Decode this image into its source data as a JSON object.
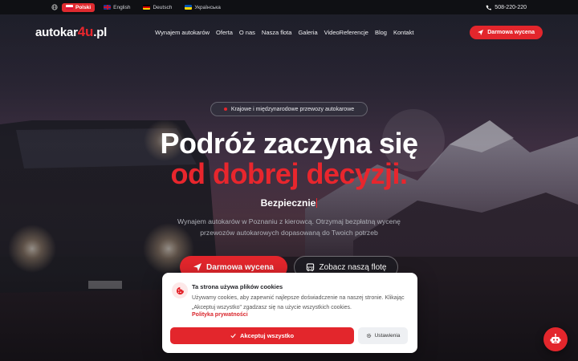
{
  "topbar": {
    "languages": [
      {
        "label": "Polski",
        "active": true
      },
      {
        "label": "English",
        "active": false
      },
      {
        "label": "Deutsch",
        "active": false
      },
      {
        "label": "Українська",
        "active": false
      }
    ],
    "phone": "508-220-220"
  },
  "nav": {
    "logo_main": "autokar",
    "logo_accent": "4u",
    "logo_suffix": ".pl",
    "links": [
      "Wynajem autokarów",
      "Oferta",
      "O nas",
      "Nasza flota",
      "Galeria",
      "VideoReferencje",
      "Blog",
      "Kontakt"
    ],
    "cta": "Darmowa wycena"
  },
  "hero": {
    "badge": "Krajowe i międzynarodowe przewozy autokarowe",
    "title_line1": "Podróż zaczyna się",
    "title_line2": "od dobrej decyzji.",
    "typed_word": "Bezpiecznie",
    "description": "Wynajem autokarów w Poznaniu z kierowcą. Otrzymaj bezpłatną wycenę przewozów autokarowych dopasowaną do Twoich potrzeb",
    "primary_button": "Darmowa wycena",
    "secondary_button": "Zobacz naszą flotę"
  },
  "cookie": {
    "title": "Ta strona używa plików cookies",
    "text": "Używamy cookies, aby zapewnić najlepsze doświadczenie na naszej stronie. Klikając „Akceptuj wszystko\" zgadzasz się na użycie wszystkich cookies.",
    "link": "Polityka prywatności",
    "accept": "Akceptuj wszystko",
    "settings": "Ustawienia"
  },
  "colors": {
    "accent": "#e3262c",
    "topbar": "#0f1014"
  }
}
